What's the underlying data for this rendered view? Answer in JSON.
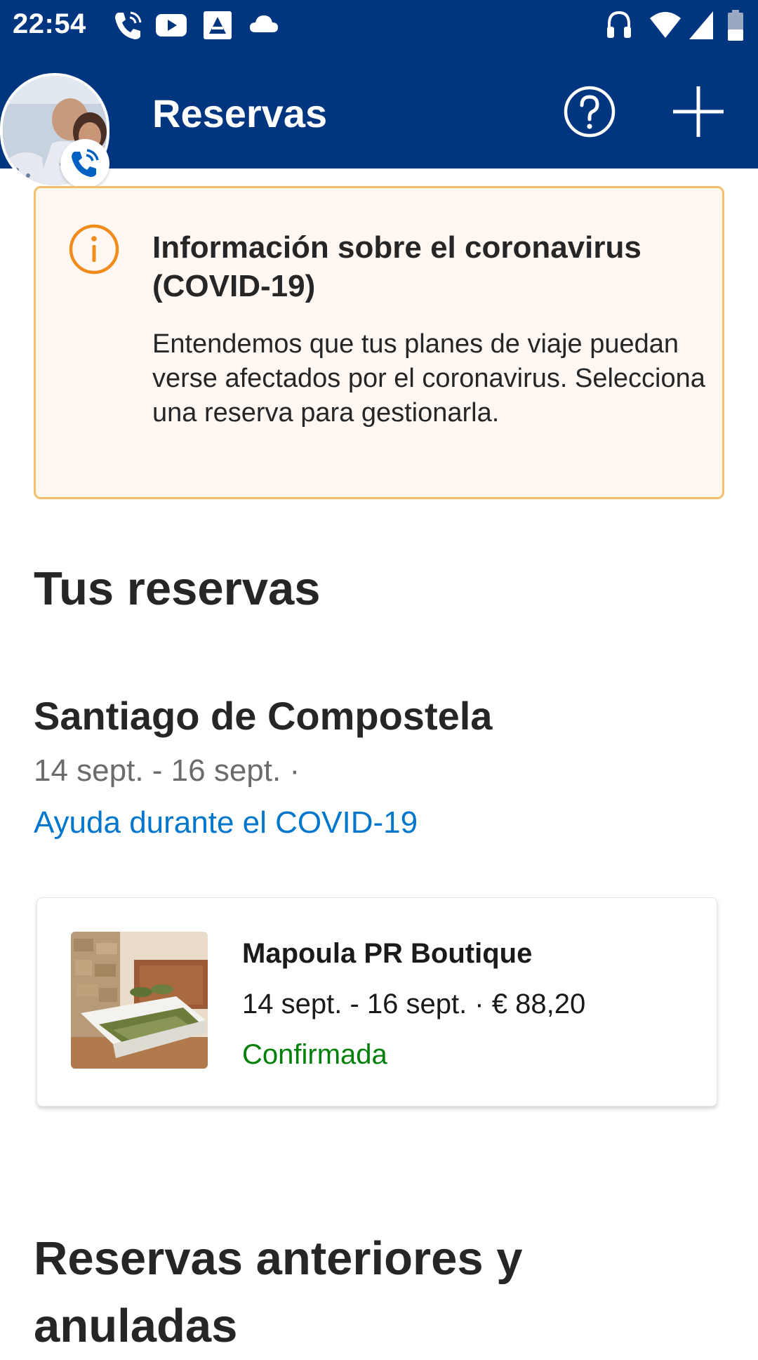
{
  "status_bar": {
    "time": "22:54",
    "left_icons": [
      "phone-call-icon",
      "youtube-icon",
      "photo-icon",
      "cloud-icon"
    ],
    "right_icons": [
      "headphones-icon",
      "wifi-icon",
      "signal-icon",
      "battery-icon"
    ]
  },
  "header": {
    "title": "Reservas",
    "help_icon": "question-circle-icon",
    "add_icon": "plus-icon",
    "avatar_badge_icon": "phone-icon"
  },
  "covid_notice": {
    "icon": "info-circle-icon",
    "title": "Información sobre el coronavirus (COVID-19)",
    "body": "Entendemos que tus planes de viaje puedan verse afectados por el coronavirus. Selecciona una reserva para gestionarla."
  },
  "bookings": {
    "section_title": "Tus reservas",
    "trips": [
      {
        "destination": "Santiago de Compostela",
        "dates": "14 sept. - 16 sept. ·",
        "help_link": "Ayuda durante el COVID-19",
        "items": [
          {
            "hotel_name": "Mapoula PR Boutique",
            "details": "14 sept. - 16 sept. · € 88,20",
            "status": "Confirmada"
          }
        ]
      }
    ]
  },
  "past_bookings": {
    "section_title": "Reservas anteriores y anuladas"
  },
  "colors": {
    "brand_blue": "#003580",
    "link_blue": "#0077cc",
    "confirmed_green": "#008009",
    "notice_border": "#f6c06a",
    "notice_background": "#fff7f2",
    "info_orange": "#f08b1c"
  }
}
